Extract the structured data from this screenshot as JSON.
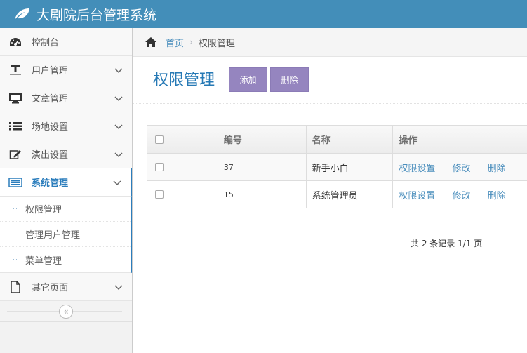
{
  "app": {
    "title": "大剧院后台管理系统"
  },
  "sidebar": {
    "items": [
      {
        "label": "控制台",
        "icon": "dashboard-icon"
      },
      {
        "label": "用户管理",
        "icon": "text-width-icon"
      },
      {
        "label": "文章管理",
        "icon": "desktop-icon"
      },
      {
        "label": "场地设置",
        "icon": "list-icon"
      },
      {
        "label": "演出设置",
        "icon": "edit-icon"
      },
      {
        "label": "系统管理",
        "icon": "list-alt-icon",
        "active": true
      },
      {
        "label": "其它页面",
        "icon": "file-icon"
      }
    ],
    "submenu": [
      {
        "label": "权限管理"
      },
      {
        "label": "管理用户管理"
      },
      {
        "label": "菜单管理"
      }
    ],
    "collapse_glyph": "«"
  },
  "breadcrumb": {
    "home": "首页",
    "current": "权限管理",
    "separator": "›"
  },
  "header": {
    "title": "权限管理",
    "add_label": "添加",
    "delete_label": "删除"
  },
  "table": {
    "columns": [
      "",
      "编号",
      "名称",
      "操作"
    ],
    "rows": [
      {
        "id": "37",
        "name": "新手小白"
      },
      {
        "id": "15",
        "name": "系统管理员"
      }
    ],
    "actions": [
      "权限设置",
      "修改",
      "删除"
    ]
  },
  "pagination": {
    "text": "共 2 条记录 1/1 页"
  },
  "colors": {
    "topbar": "#438eb9",
    "accent": "#2b7dbc",
    "button": "#9585bf"
  }
}
